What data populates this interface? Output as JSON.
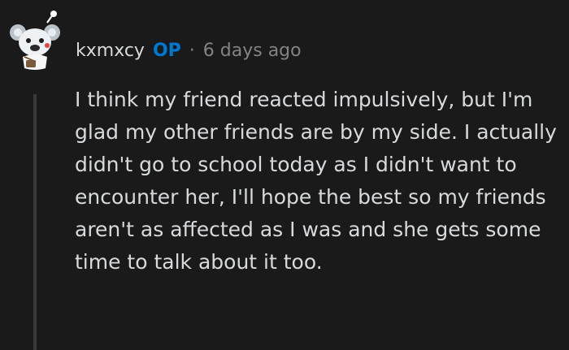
{
  "comment": {
    "author": "kxmxcy",
    "op_label": "OP",
    "separator": "·",
    "age": "6 days ago",
    "avatar_icon": "snoo-avatar-icon",
    "body": "I think my friend reacted impulsively, but I'm glad my other friends are by my side. I actually didn't go to school today as I didn't want to encounter her, I'll hope the best so my friends aren't as affected as I was and she gets some time to talk about it too."
  },
  "colors": {
    "background": "#1a1a1b",
    "text": "#d7dadc",
    "muted": "#818384",
    "op": "#0079d3",
    "thread_line": "#3a3a3c"
  }
}
